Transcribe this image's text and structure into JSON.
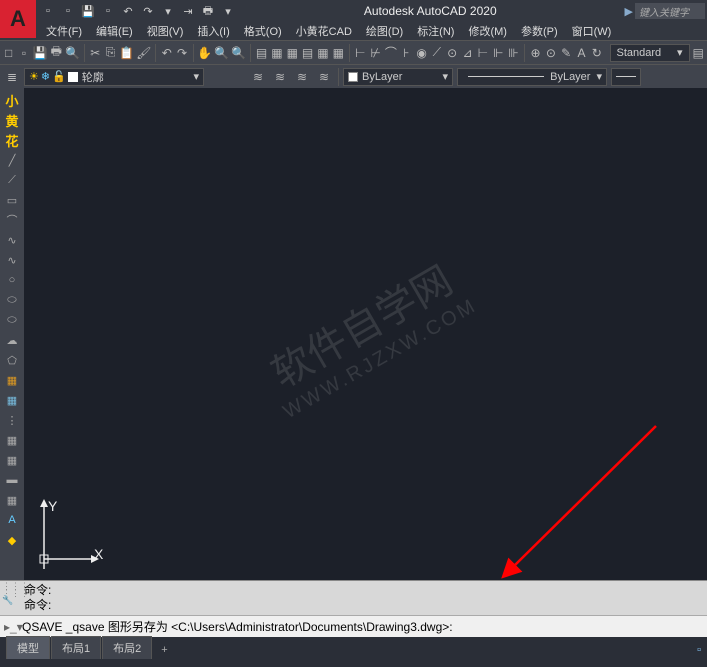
{
  "app": {
    "title": "Autodesk AutoCAD 2020",
    "logo_letter": "A",
    "search_placeholder": "键入关键字"
  },
  "menu": {
    "file": "文件(F)",
    "edit": "编辑(E)",
    "view": "视图(V)",
    "insert": "插入(I)",
    "format": "格式(O)",
    "xhh": "小黄花CAD",
    "draw": "绘图(D)",
    "dimension": "标注(N)",
    "modify": "修改(M)",
    "param": "参数(P)",
    "window": "窗口(W)"
  },
  "toolbar": {
    "standard_label": "Standard"
  },
  "layers": {
    "name_label": "轮廓",
    "bylayer_main": "ByLayer",
    "bylayer_line": "ByLayer"
  },
  "sidebar": {
    "v1": "小",
    "v2": "黄",
    "v3": "花"
  },
  "ucs": {
    "x": "X",
    "y": "Y"
  },
  "watermark": {
    "line1": "软件自学网",
    "line2": "WWW.RJZXW.COM"
  },
  "command": {
    "prompt1": "命令:",
    "prompt2": "命令:",
    "input": "QSAVE _qsave 图形另存为 <C:\\Users\\Administrator\\Documents\\Drawing3.dwg>:"
  },
  "tabs": {
    "model": "模型",
    "layout1": "布局1",
    "layout2": "布局2",
    "plus": "+"
  }
}
